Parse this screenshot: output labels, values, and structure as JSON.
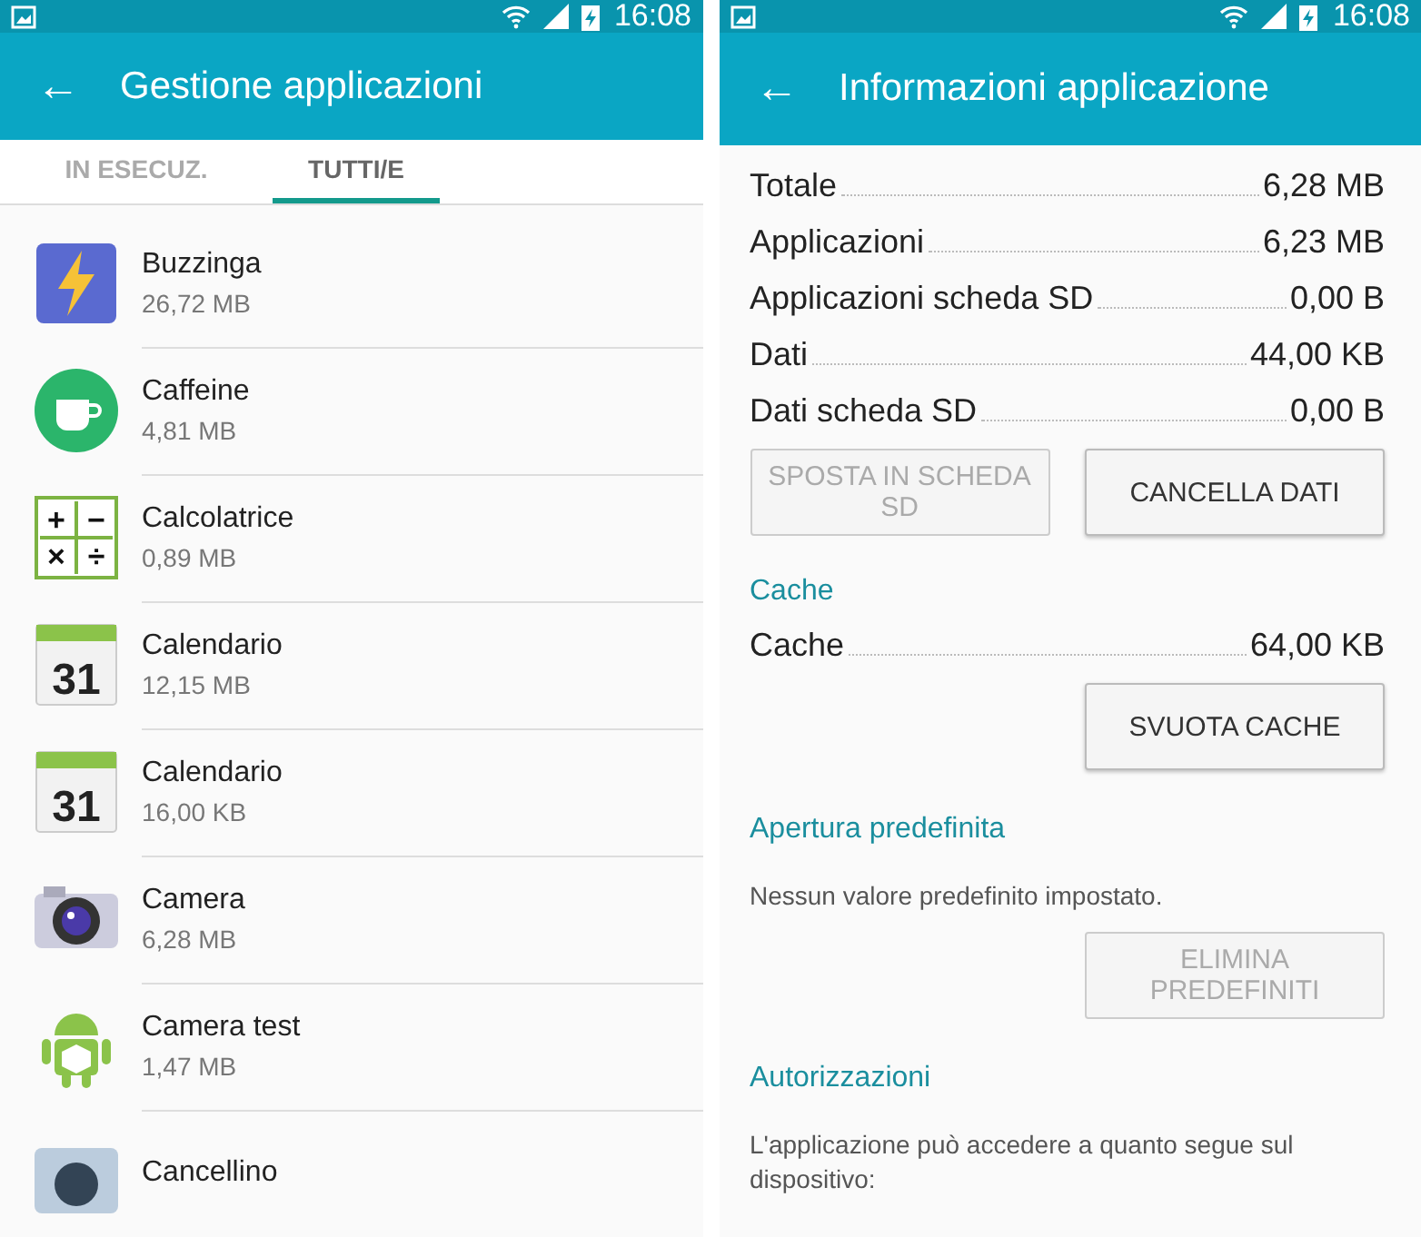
{
  "left_screen": {
    "status_bar": {
      "time": "16:08"
    },
    "app_bar": {
      "back": "←",
      "title": "Gestione applicazioni"
    },
    "tabs": [
      {
        "label": "IN ESECUZ.",
        "selected": false
      },
      {
        "label": "TUTTI/E",
        "selected": true
      }
    ],
    "apps": [
      {
        "name": "Buzzinga",
        "size": "26,72 MB"
      },
      {
        "name": "Caffeine",
        "size": "4,81 MB"
      },
      {
        "name": "Calcolatrice",
        "size": "0,89 MB",
        "icon_text": [
          "+",
          "−",
          "×",
          "÷"
        ]
      },
      {
        "name": "Calendario",
        "size": "12,15 MB",
        "icon_text": [
          "31"
        ]
      },
      {
        "name": "Calendario",
        "size": "16,00 KB",
        "icon_text": [
          "31"
        ]
      },
      {
        "name": "Camera",
        "size": "6,28 MB"
      },
      {
        "name": "Camera test",
        "size": "1,47 MB"
      },
      {
        "name": "Cancellino"
      }
    ]
  },
  "right_screen": {
    "status_bar": {
      "time": "16:08"
    },
    "app_bar": {
      "back": "←",
      "title": "Informazioni applicazione"
    },
    "storage": [
      {
        "label": "Totale",
        "value": "6,28 MB"
      },
      {
        "label": "Applicazioni",
        "value": "6,23 MB"
      },
      {
        "label": "Applicazioni scheda SD",
        "value": "0,00 B"
      },
      {
        "label": "Dati",
        "value": "44,00 KB"
      },
      {
        "label": "Dati scheda SD",
        "value": "0,00 B"
      }
    ],
    "storage_buttons": [
      {
        "label": "SPOSTA IN SCHEDA SD",
        "disabled": true
      },
      {
        "label": "CANCELLA DATI",
        "disabled": false
      }
    ],
    "cache": {
      "header": "Cache",
      "label": "Cache",
      "value": "64,00 KB",
      "button": {
        "label": "SVUOTA CACHE",
        "disabled": false
      }
    },
    "defaults": {
      "header": "Apertura predefinita",
      "text": "Nessun valore predefinito impostato.",
      "button": {
        "label": "ELIMINA PREDEFINITI",
        "disabled": true
      }
    },
    "permissions": {
      "header": "Autorizzazioni",
      "text": "L'applicazione può accedere a quanto segue sul dispositivo:"
    }
  }
}
